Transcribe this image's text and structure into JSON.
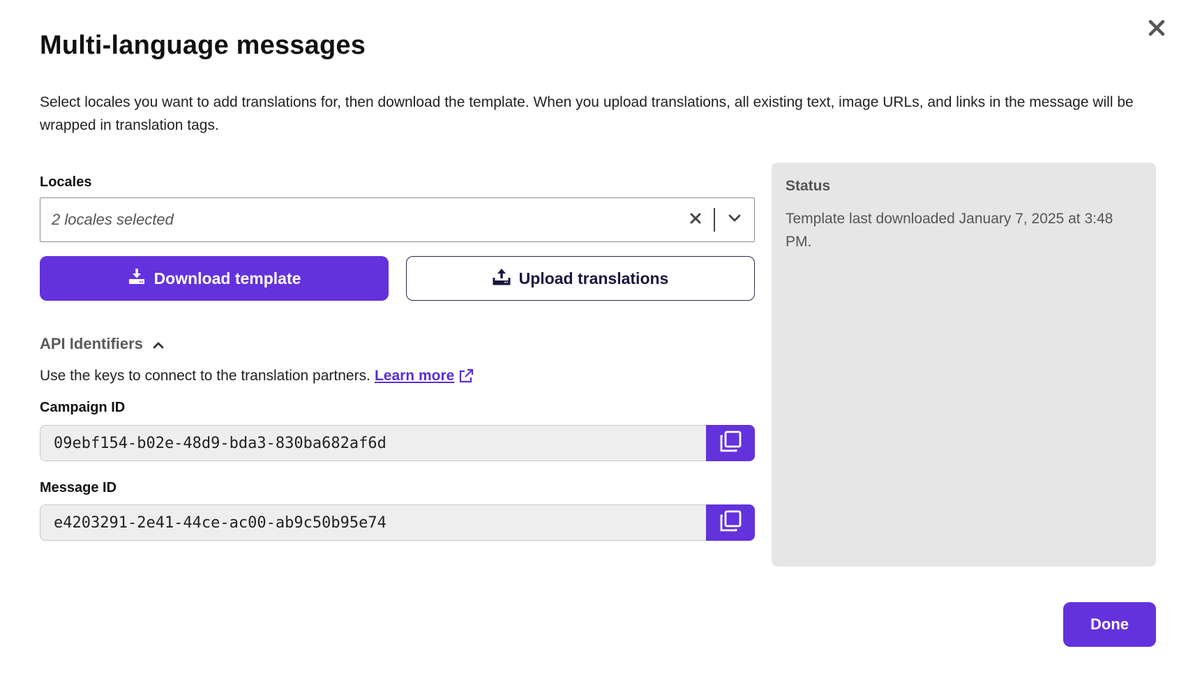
{
  "dialog": {
    "title": "Multi-language messages",
    "description": "Select locales you want to add translations for, then download the template. When you upload translations, all existing text, image URLs, and links in the message will be wrapped in translation tags."
  },
  "locales": {
    "label": "Locales",
    "value": "2 locales selected"
  },
  "actions": {
    "download_label": "Download template",
    "upload_label": "Upload translations",
    "done_label": "Done"
  },
  "api": {
    "toggle_label": "API Identifiers",
    "expanded": true,
    "description": "Use the keys to connect to the translation partners.",
    "learn_more": "Learn more",
    "campaign_label": "Campaign ID",
    "campaign_id": "09ebf154-b02e-48d9-bda3-830ba682af6d",
    "message_label": "Message ID",
    "message_id": "e4203291-2e41-44ce-ac00-ab9c50b95e74"
  },
  "status": {
    "title": "Status",
    "text": "Template last downloaded January 7, 2025 at 3:48 PM."
  },
  "colors": {
    "primary": "#6332dc",
    "status_bg": "#e6e6e6",
    "field_bg": "#eeeeee"
  },
  "icons": [
    "close-icon",
    "clear-icon",
    "chevron-down-icon",
    "download-icon",
    "upload-icon",
    "chevron-up-icon",
    "external-link-icon",
    "copy-icon"
  ]
}
